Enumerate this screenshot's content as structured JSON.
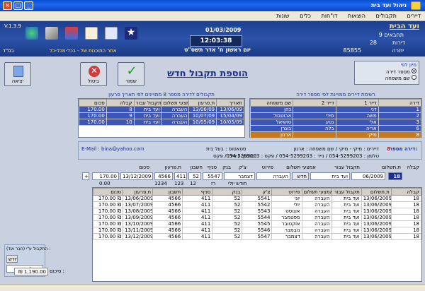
{
  "window": {
    "title": "ניהול ועד בית"
  },
  "menu": [
    "דיירים",
    "תקבולים",
    "הוצאות",
    "דו\"חות",
    "כלים",
    "שונות"
  ],
  "banner": {
    "date": "01/03/2009",
    "time": "12:03:38",
    "greeting": "יום ראשון ח' אדר תשס\"ט",
    "version": "V.1.3.9",
    "left_tag": "בס\"ד",
    "site": "אתר התוכנות של - בכל-מכל-כל",
    "org_title": "ועד הבית",
    "stats": [
      {
        "label": "דירות",
        "value": "28"
      },
      {
        "label": "יתרה",
        "value": "85855"
      }
    ],
    "top_line": "תחבאים 9"
  },
  "toolbar_icons": [
    "globe-icon",
    "tools-icon",
    "charts-icon",
    "document-icon",
    "edit-icon",
    "star-icon"
  ],
  "form": {
    "heading": "הוספת תקבול חדש",
    "save_label": "שמור",
    "cancel_label": "ביטול",
    "exit_label": "יציאה",
    "sort_title": "מיון לפי",
    "sort_options": [
      "מספר דירה",
      "שם משפחה"
    ],
    "sort_selected": 0
  },
  "tenants": {
    "title": "רשימת דיירים ממויינת לפי מספר דירה",
    "columns": [
      "דירה",
      "דייר 1",
      "דייר 2",
      "שם משפחה"
    ],
    "rows": [
      [
        "1",
        "דני",
        "",
        "כהן"
      ],
      [
        "2",
        "משה",
        "מירי",
        "אבוטבול"
      ],
      [
        "3",
        "אלי",
        "נטע",
        "סושיאל"
      ],
      [
        "6",
        "אריה",
        "בלה",
        "בוגרן"
      ],
      [
        "8",
        "מיקי",
        "",
        "ארנון"
      ]
    ],
    "selected_rows": [
      0,
      1,
      2,
      3
    ],
    "current_row": 4
  },
  "recent": {
    "title": "תקבולים לדירה מספר 8 ממויינים לפי תאריך פרעון",
    "columns": [
      "תאריך",
      "ת.פרעון",
      "אמצעי תשלום",
      "תקבול עבור",
      "קבלה",
      "סכום"
    ],
    "rows": [
      [
        "13/06/09",
        "13/06/09",
        "העברה",
        "ועד בית",
        "8",
        "170.00"
      ],
      [
        "15/04/09",
        "10/07/09",
        "העברה",
        "ועד בית",
        "9",
        "170.00"
      ],
      [
        "10/05/09",
        "10/05/09",
        "העברה",
        "ועד בית",
        "10",
        "170.00"
      ]
    ]
  },
  "tenant_info": {
    "apt_label": "דירה מספר:",
    "apt_value": "8",
    "line1": "דיירים : מיקי - מיקי  / שם משפחה : ארנון",
    "status": "סטאטוס : בעל בית",
    "email": "E-Mail : bina@yahoo.com",
    "line2": "טלפון : 054-5299203 / נייד : 054-5299203 / פקס : 054-5299203",
    "line3": "טלפון: / נייד: / פקס:"
  },
  "entry": {
    "labels": [
      "קבלה",
      "ת.תשלום",
      "תקבול עבור",
      "אמצעי תשלום",
      "פירוט",
      "צ'ק",
      "בנק",
      "סניף",
      "חשבון",
      "ת.פרעון",
      "סכום"
    ],
    "values": {
      "receipt": "18",
      "pay_date": "06/2009",
      "for": "ועד בית",
      "new_btn": "חדש",
      "method": "העברה",
      "detail": "דצמבר",
      "cheque": "5547",
      "bank": "52",
      "branch": "411",
      "account": "4566",
      "due": "13/12/2009",
      "amount": "170.00"
    },
    "add_btn": "+",
    "sub_detail": "חודש יולי",
    "sub_cheque": "רז",
    "sub_bank": "12",
    "sub_branch": "123",
    "sub_account": "1234",
    "sub_amount": "0.00"
  },
  "payments": {
    "columns": [
      "קבלה",
      "ת.תשלום",
      "תקבול עבור",
      "אמצעי תשלום",
      "פירוט",
      "צ'ק",
      "בנק",
      "סניף",
      "חשבון",
      "ת.פרעון",
      "סכום"
    ],
    "rows": [
      [
        "18",
        "13/06/2009",
        "ועד בית",
        "העברה",
        "יוני",
        "5541",
        "52",
        "411",
        "4566",
        "13/06/2009",
        "170.00 ₪"
      ],
      [
        "18",
        "13/06/2009",
        "ועד בית",
        "העברה",
        "יולי",
        "5542",
        "52",
        "411",
        "4566",
        "13/07/2009",
        "170.00 ₪"
      ],
      [
        "18",
        "13/06/2009",
        "ועד בית",
        "העברה",
        "אוגוסט",
        "5543",
        "52",
        "411",
        "4566",
        "13/08/2009",
        "170.00 ₪"
      ],
      [
        "18",
        "13/06/2009",
        "ועד בית",
        "העברה",
        "ספטמבר",
        "5544",
        "52",
        "411",
        "4566",
        "13/09/2009",
        "170.00 ₪"
      ],
      [
        "18",
        "13/06/2009",
        "ועד בית",
        "העברה",
        "אוקטובר",
        "5545",
        "52",
        "411",
        "4566",
        "13/10/2009",
        "170.00 ₪"
      ],
      [
        "18",
        "13/06/2009",
        "ועד בית",
        "העברה",
        "נובמבר",
        "5546",
        "52",
        "411",
        "4566",
        "13/11/2009",
        "170.00 ₪"
      ],
      [
        "18",
        "13/06/2009",
        "ועד בית",
        "העברה",
        "דצמבר",
        "5547",
        "52",
        "411",
        "4566",
        "13/12/2009",
        "170.00 ₪"
      ]
    ]
  },
  "side": {
    "title": "התקבול ע\"י (חבר ועד) :",
    "new_btn": "חדש",
    "member": "הנהלה",
    "total_label": "סיכום :",
    "total_value": "₪ 1,190.00"
  },
  "colors": {
    "banner": "#1e3f8f",
    "accent": "#1b2f8f",
    "selection": "#3c56b8",
    "current": "#c47a1e"
  }
}
